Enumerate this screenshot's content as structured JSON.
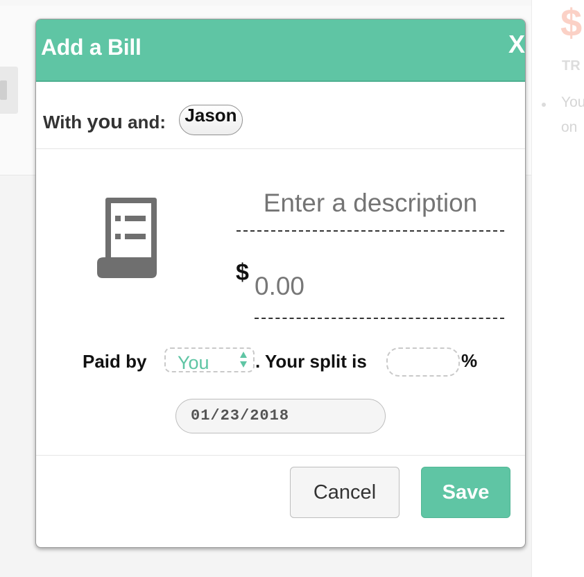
{
  "background": {
    "right_panel": {
      "currency_symbol": "$",
      "heading": "TR",
      "line1": "You",
      "line2": "on"
    }
  },
  "modal": {
    "title": "Add a Bill",
    "close_label": "X",
    "with_label_prefix": "With ",
    "with_label_strong": "you",
    "with_label_suffix": " and:",
    "participants": [
      "Jason"
    ],
    "description_placeholder": "Enter a description",
    "description_value": "",
    "currency_symbol": "$",
    "amount_placeholder": "0.00",
    "amount_value": "",
    "paid_by_label": "Paid by",
    "payer_selected": "You",
    "split_label": ". Your split is",
    "split_value": "",
    "percent_symbol": "%",
    "date": "01/23/2018",
    "cancel_label": "Cancel",
    "save_label": "Save"
  },
  "colors": {
    "accent": "#5fc5a4",
    "dollar_bg": "#fbd1c6"
  },
  "icons": {
    "receipt": "receipt-icon",
    "select_arrows": "up-down-arrows-icon"
  }
}
